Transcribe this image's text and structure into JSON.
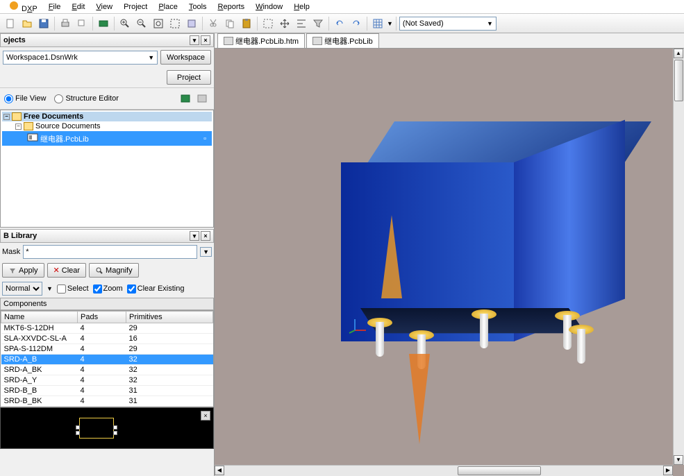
{
  "menu": {
    "items": [
      "DXP",
      "File",
      "Edit",
      "View",
      "Project",
      "Place",
      "Tools",
      "Reports",
      "Window",
      "Help"
    ]
  },
  "toolbar": {
    "combo": "(Not Saved)"
  },
  "projects": {
    "title": "ojects",
    "workspace": "Workspace1.DsnWrk",
    "workspace_btn": "Workspace",
    "project_btn": "Project",
    "fileview": "File View",
    "structed": "Structure Editor",
    "tree": {
      "root": "Free Documents",
      "child": "Source Documents",
      "leaf": "继电器.PcbLib"
    }
  },
  "library": {
    "title": "B Library",
    "mask_label": "Mask",
    "mask_value": "*",
    "apply": "Apply",
    "clear": "Clear",
    "magnify": "Magnify",
    "mode": "Normal",
    "select": "Select",
    "zoom": "Zoom",
    "clearex": "Clear Existing",
    "comp_label": "Components",
    "cols": {
      "name": "Name",
      "pads": "Pads",
      "prim": "Primitives"
    },
    "rows": [
      {
        "name": "MKT6-S-12DH",
        "pads": "4",
        "prim": "29"
      },
      {
        "name": "SLA-XXVDC-SL-A",
        "pads": "4",
        "prim": "16"
      },
      {
        "name": "SPA-S-112DM",
        "pads": "4",
        "prim": "29"
      },
      {
        "name": "SRD-A_B",
        "pads": "4",
        "prim": "32"
      },
      {
        "name": "SRD-A_BK",
        "pads": "4",
        "prim": "32"
      },
      {
        "name": "SRD-A_Y",
        "pads": "4",
        "prim": "32"
      },
      {
        "name": "SRD-B_B",
        "pads": "4",
        "prim": "31"
      },
      {
        "name": "SRD-B_BK",
        "pads": "4",
        "prim": "31"
      }
    ],
    "selected_index": 3
  },
  "tabs3d": {
    "tab1": "继电器.PcbLib.htm",
    "tab2": "继电器.PcbLib"
  }
}
